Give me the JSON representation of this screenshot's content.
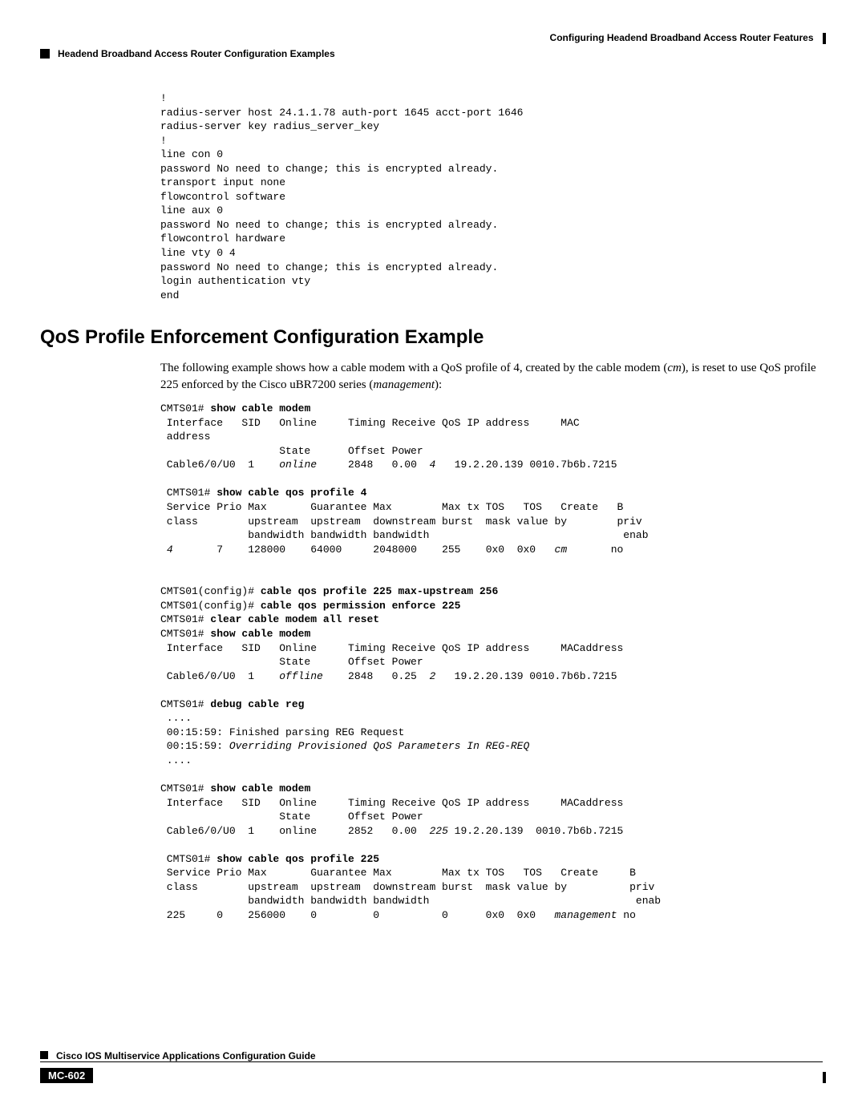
{
  "header": {
    "chapter": "Configuring Headend Broadband Access Router Features",
    "section": "Headend Broadband Access Router Configuration Examples"
  },
  "code1": "!\nradius-server host 24.1.1.78 auth-port 1645 acct-port 1646\nradius-server key radius_server_key\n!\nline con 0\npassword No need to change; this is encrypted already.\ntransport input none\nflowcontrol software\nline aux 0\npassword No need to change; this is encrypted already.\nflowcontrol hardware\nline vty 0 4\npassword No need to change; this is encrypted already.\nlogin authentication vty\nend",
  "section_title": "QoS Profile Enforcement Configuration Example",
  "intro_html": "The following example shows how a cable modem with a QoS profile of 4, created by the cable modem (<i>cm</i>), is reset to use QoS profile 225 enforced by the Cisco uBR7200 series (<i>management</i>):",
  "terminal_html": "CMTS01# <b>show cable modem</b>\n Interface   SID   Online     Timing Receive QoS IP address     MAC\n address\n                   State      Offset Power\n Cable6/0/U0  1    <i>online</i>     2848   0.00  <i>4</i>   19.2.20.139 0010.7b6b.7215\n\n CMTS01# <b>show cable qos profile 4</b>\n Service Prio Max       Guarantee Max        Max tx TOS   TOS   Create   B\n class        upstream  upstream  downstream burst  mask value by        priv\n              bandwidth bandwidth bandwidth                               enab\n <i>4</i>       7    128000    64000     2048000    255    0x0  0x0   <i>cm</i>       no\n\n\nCMTS01(config)# <b>cable qos profile 225 max-upstream 256</b>\nCMTS01(config)# <b>cable qos permission enforce 225</b>\nCMTS01# <b>clear cable modem all reset</b>\nCMTS01# <b>show cable modem</b>\n Interface   SID   Online     Timing Receive QoS IP address     MACaddress\n                   State      Offset Power\n Cable6/0/U0  1    <i>offline</i>    2848   0.25  <i>2</i>   19.2.20.139 0010.7b6b.7215\n\nCMTS01# <b>debug cable reg</b>\n ....\n 00:15:59: Finished parsing REG Request\n 00:15:59: <i>Overriding Provisioned QoS Parameters In REG-REQ</i>\n ....\n\nCMTS01# <b>show cable modem</b>\n Interface   SID   Online     Timing Receive QoS IP address     MACaddress\n                   State      Offset Power\n Cable6/0/U0  1    online     2852   0.00  <i>225</i> 19.2.20.139  0010.7b6b.7215\n\n CMTS01# <b>show cable qos profile 225</b>\n Service Prio Max       Guarantee Max        Max tx TOS   TOS   Create     B\n class        upstream  upstream  downstream burst  mask value by          priv\n              bandwidth bandwidth bandwidth                                 enab\n 225     0    256000    0         0          0      0x0  0x0   <i>management</i> no",
  "footer": {
    "guide": "Cisco IOS Multiservice Applications Configuration Guide",
    "page": "MC-602"
  }
}
